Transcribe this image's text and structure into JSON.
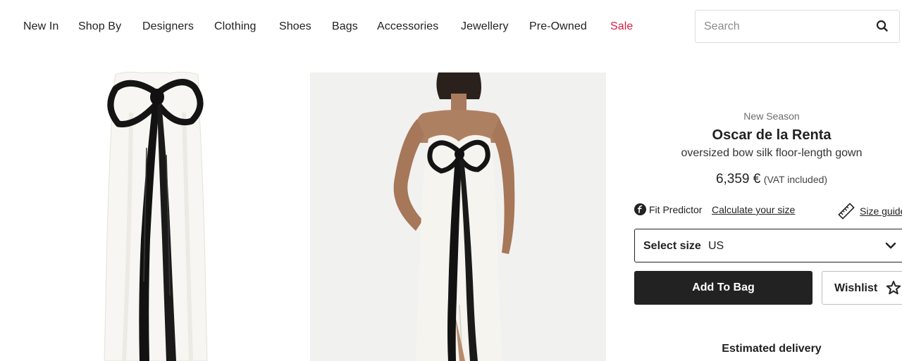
{
  "nav": {
    "items": [
      {
        "label": "New In"
      },
      {
        "label": "Shop By"
      },
      {
        "label": "Designers"
      },
      {
        "label": "Clothing"
      },
      {
        "label": "Shoes"
      },
      {
        "label": "Bags"
      },
      {
        "label": "Accessories"
      },
      {
        "label": "Jewellery"
      },
      {
        "label": "Pre-Owned"
      },
      {
        "label": "Sale"
      }
    ],
    "sale_color": "#d61f44"
  },
  "search": {
    "placeholder": "Search",
    "icon": "search-icon"
  },
  "product": {
    "season": "New Season",
    "brand": "Oscar de la Renta",
    "description": "oversized bow silk floor-length gown",
    "price": "6,359 €",
    "vat_note": "(VAT included)",
    "fit_predictor_label": "Fit Predictor",
    "fit_predictor_link": "Calculate your size",
    "size_guide_label": "Size guide",
    "size_select_label": "Select size",
    "size_select_value": "US",
    "add_to_bag_label": "Add To Bag",
    "wishlist_label": "Wishlist",
    "delivery_heading": "Estimated delivery"
  },
  "colors": {
    "primary_button": "#222222",
    "text": "#222222"
  }
}
